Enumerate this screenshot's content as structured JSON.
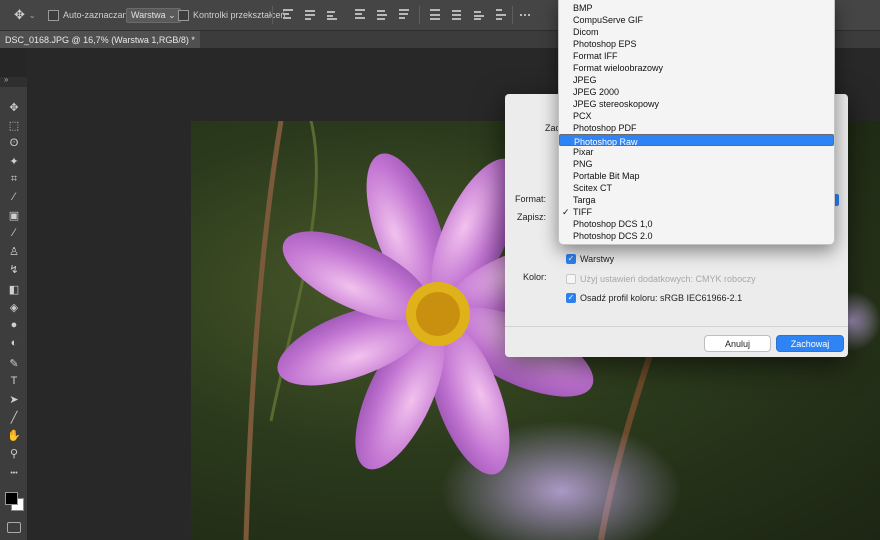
{
  "options_bar": {
    "auto_select_label": "Auto-zaznaczanie:",
    "auto_select_value": "Warstwa",
    "transform_controls_label": "Kontrolki przekształceń"
  },
  "document_tab": {
    "title": "DSC_0168.JPG @ 16,7% (Warstwa 1,RGB/8) *"
  },
  "dialog": {
    "save_as_label_partial": "Zac",
    "format_label": "Format:",
    "save_label": "Zapisz:",
    "layers_label": "Warstwy",
    "color_label": "Kolor:",
    "proof_setup_label": "Użyj ustawień dodatkowych:  CMYK roboczy",
    "embed_profile_label": "Osadź profil koloru:  sRGB IEC61966-2.1",
    "cancel_button": "Anuluj",
    "save_button": "Zachowaj"
  },
  "format_menu": {
    "items": [
      {
        "label": "BMP",
        "selected": false,
        "checked": false
      },
      {
        "label": "CompuServe GIF",
        "selected": false,
        "checked": false
      },
      {
        "label": "Dicom",
        "selected": false,
        "checked": false
      },
      {
        "label": "Photoshop EPS",
        "selected": false,
        "checked": false
      },
      {
        "label": "Format IFF",
        "selected": false,
        "checked": false
      },
      {
        "label": "Format wieloobrazowy",
        "selected": false,
        "checked": false
      },
      {
        "label": "JPEG",
        "selected": false,
        "checked": false
      },
      {
        "label": "JPEG 2000",
        "selected": false,
        "checked": false
      },
      {
        "label": "JPEG stereoskopowy",
        "selected": false,
        "checked": false
      },
      {
        "label": "PCX",
        "selected": false,
        "checked": false
      },
      {
        "label": "Photoshop PDF",
        "selected": false,
        "checked": false
      },
      {
        "label": "Photoshop Raw",
        "selected": true,
        "checked": false
      },
      {
        "label": "Pixar",
        "selected": false,
        "checked": false
      },
      {
        "label": "PNG",
        "selected": false,
        "checked": false
      },
      {
        "label": "Portable Bit Map",
        "selected": false,
        "checked": false
      },
      {
        "label": "Scitex CT",
        "selected": false,
        "checked": false
      },
      {
        "label": "Targa",
        "selected": false,
        "checked": false
      },
      {
        "label": "TIFF",
        "selected": false,
        "checked": true
      },
      {
        "label": "Photoshop DCS 1,0",
        "selected": false,
        "checked": false
      },
      {
        "label": "Photoshop DCS 2.0",
        "selected": false,
        "checked": false
      }
    ],
    "checkmark": "✓"
  },
  "tools": [
    {
      "name": "move-tool-icon",
      "glyph": "✥"
    },
    {
      "name": "marquee-tool-icon",
      "glyph": "⬚"
    },
    {
      "name": "lasso-tool-icon",
      "glyph": "ʘ"
    },
    {
      "name": "magic-wand-tool-icon",
      "glyph": "✦"
    },
    {
      "name": "crop-tool-icon",
      "glyph": "⌗"
    },
    {
      "name": "eyedropper-tool-icon",
      "glyph": "⁄"
    },
    {
      "name": "patch-tool-icon",
      "glyph": "▣"
    },
    {
      "name": "brush-tool-icon",
      "glyph": "∕"
    },
    {
      "name": "stamp-tool-icon",
      "glyph": "♙"
    },
    {
      "name": "history-brush-tool-icon",
      "glyph": "↯"
    },
    {
      "name": "eraser-tool-icon",
      "glyph": "◧"
    },
    {
      "name": "paint-bucket-tool-icon",
      "glyph": "◈"
    },
    {
      "name": "blur-tool-icon",
      "glyph": "●"
    },
    {
      "name": "dodge-tool-icon",
      "glyph": "◐"
    },
    {
      "name": "pen-tool-icon",
      "glyph": "✎"
    },
    {
      "name": "type-tool-icon",
      "glyph": "T"
    },
    {
      "name": "path-select-tool-icon",
      "glyph": "➤"
    },
    {
      "name": "line-tool-icon",
      "glyph": "╱"
    },
    {
      "name": "hand-tool-icon",
      "glyph": "✋"
    },
    {
      "name": "zoom-tool-icon",
      "glyph": "⚲"
    },
    {
      "name": "more-tools-icon",
      "glyph": "•••"
    }
  ]
}
